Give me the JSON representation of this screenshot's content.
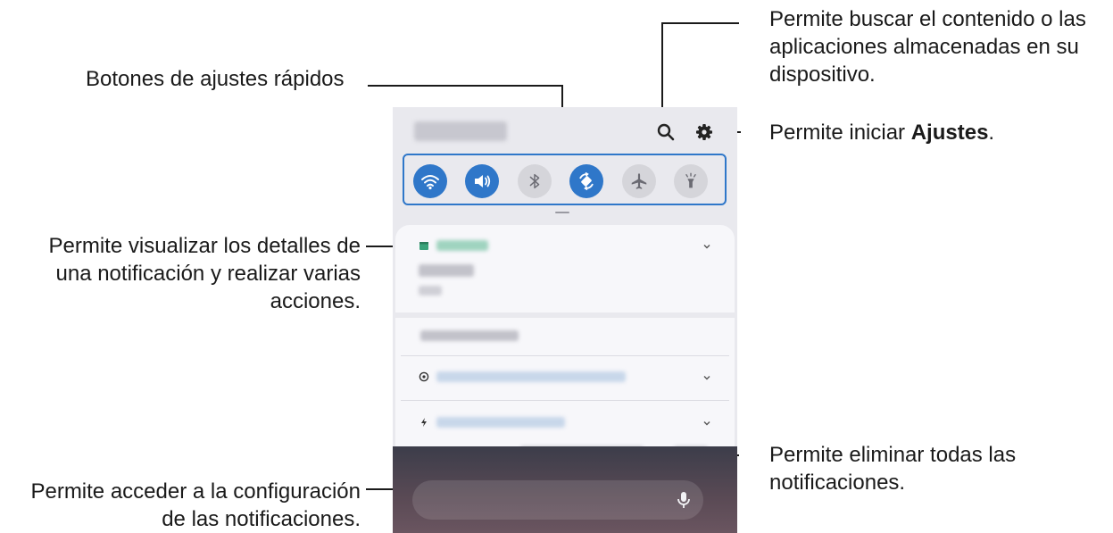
{
  "callouts": {
    "search_desc": "Permite buscar el contenido o las aplicaciones almacenadas en su dispositivo.",
    "search_lines": [
      "Permite buscar el contenido o las",
      "aplicaciones almacenadas en su",
      "dispositivo."
    ],
    "settings_prefix": "Permite iniciar ",
    "settings_bold": "Ajustes",
    "settings_suffix": ".",
    "quick_settings": "Botones de ajustes rápidos",
    "notification_lines": [
      "Permite visualizar los detalles de",
      "una notificación y realizar varias",
      "acciones."
    ],
    "clear_lines": [
      "Permite eliminar todas las",
      "notificaciones."
    ],
    "notif_settings_lines": [
      "Permite acceder a la configuración",
      "de las notificaciones."
    ]
  },
  "phone": {
    "icons": {
      "search": "search-icon",
      "settings": "gear-icon",
      "mic": "microphone-icon"
    },
    "quick_settings": [
      {
        "name": "wifi-icon",
        "state": "on"
      },
      {
        "name": "sound-icon",
        "state": "on"
      },
      {
        "name": "bluetooth-icon",
        "state": "off"
      },
      {
        "name": "auto-rotate-icon",
        "state": "on"
      },
      {
        "name": "airplane-mode-icon",
        "state": "off"
      },
      {
        "name": "flashlight-icon",
        "state": "off"
      }
    ]
  },
  "colors": {
    "accent": "#2f77c9",
    "calendar": "#3aa37a",
    "line": "#1a1a1a"
  }
}
